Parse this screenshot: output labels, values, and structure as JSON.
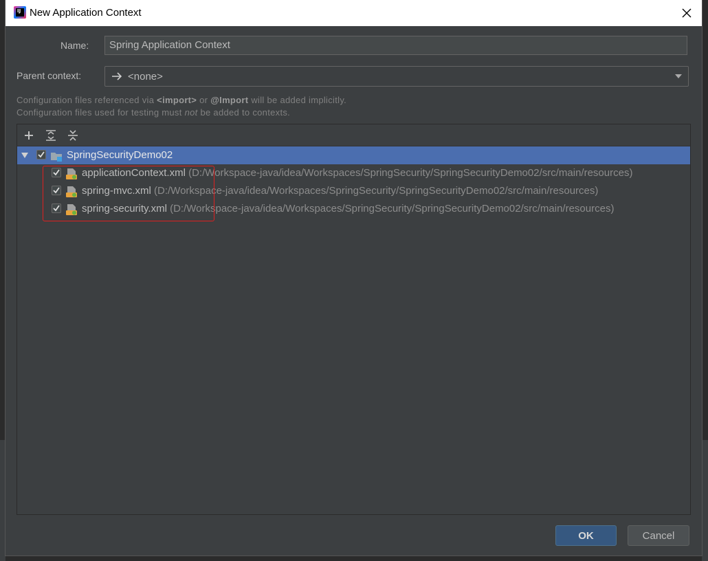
{
  "window": {
    "title": "New Application Context",
    "icon": "intellij-idea-icon"
  },
  "form": {
    "name_label": "Name:",
    "name_value": "Spring Application Context",
    "parent_label": "Parent context:",
    "parent_value": "<none>"
  },
  "hints": {
    "line1_pre": "Configuration files referenced via ",
    "line1_import_tag": "<import>",
    "line1_mid": " or ",
    "line1_import_anno": "@Import",
    "line1_post": " will be added implicitly.",
    "line2_pre": "Configuration files used for testing must ",
    "line2_em": "not",
    "line2_post": " be added to contexts."
  },
  "tree": {
    "root": {
      "label": "SpringSecurityDemo02",
      "checked": true,
      "expanded": true
    },
    "items": [
      {
        "name": "applicationContext.xml",
        "path": "(D:/Workspace-java/idea/Workspaces/SpringSecurity/SpringSecurityDemo02/src/main/resources)",
        "checked": true
      },
      {
        "name": "spring-mvc.xml",
        "path": "(D:/Workspace-java/idea/Workspaces/SpringSecurity/SpringSecurityDemo02/src/main/resources)",
        "checked": true
      },
      {
        "name": "spring-security.xml",
        "path": "(D:/Workspace-java/idea/Workspaces/SpringSecurity/SpringSecurityDemo02/src/main/resources)",
        "checked": true
      }
    ]
  },
  "buttons": {
    "ok": "OK",
    "cancel": "Cancel"
  },
  "colors": {
    "selection": "#4b6eaf",
    "highlight_box": "#e02020",
    "ok_button": "#365880"
  }
}
